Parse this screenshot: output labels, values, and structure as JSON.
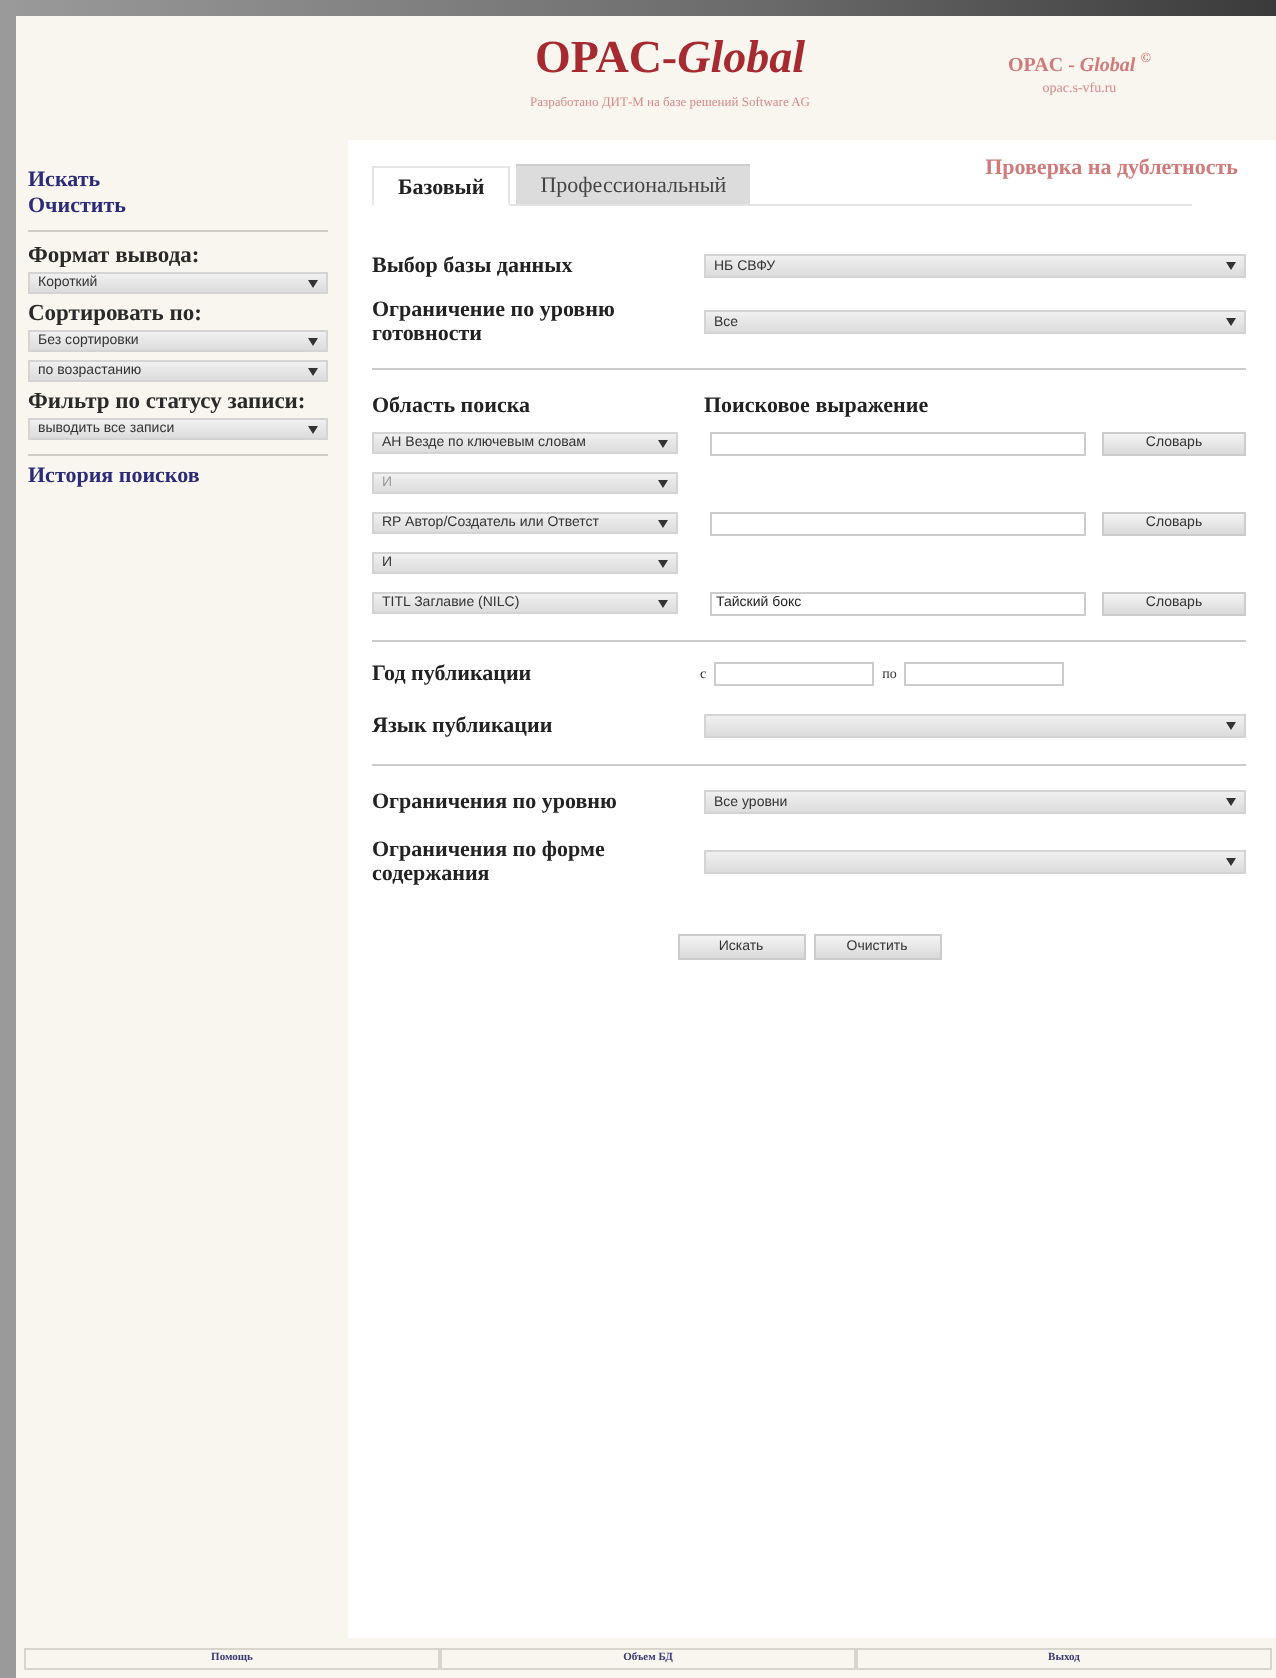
{
  "header": {
    "title": "OPAC-*Global*",
    "subtitle": "Разработано ДИТ-М на базе решений Software AG",
    "brand": "OPAC - *Global* $^{©}$",
    "site": "opac.s-vfu.ru"
  },
  "sidebar": {
    "links": [
      "Искать",
      "Очистить"
    ],
    "sections": [
      {
        "label": "Формат вывода:",
        "selects": [
          "Короткий"
        ]
      },
      {
        "label": "Сортировать по:",
        "selects": [
          "Без сортировки",
          "по возрастанию"
        ]
      },
      {
        "label": "Фильтр по статусу записи:",
        "selects": [
          "выводить все записи"
        ]
      }
    ],
    "history": "История поисков"
  },
  "tabs": [
    {
      "label": "Базовый",
      "selected": true
    },
    {
      "label": "Профессиональный",
      "selected": false
    }
  ],
  "duplicate_check": "Проверка на дублетность",
  "top_rows": [
    {
      "label": "Выбор базы данных",
      "value": "НБ СВФУ"
    },
    {
      "label": "Ограничение по уровню готовности",
      "value": "Все"
    }
  ],
  "search": {
    "area_header": "Область поиска",
    "expression_header": "Поисковое выражение",
    "rows": [
      {
        "field": "АН Везде по ключевым словам",
        "button": "Словарь"
      },
      {
        "operator": "И",
        "operator_disabled": true,
        "field": "RP Автор/Создатель или Ответст",
        "button": "Словарь"
      },
      {
        "operator": "И",
        "operator_disabled": false,
        "field": "TITL Заглавие (NILC)",
        "value": "Тайский бокс",
        "button": "Словарь"
      }
    ]
  },
  "year": {
    "label": "Год публикации",
    "from_label": "с",
    "to_label": "по"
  },
  "language": {
    "label": "Язык публикации"
  },
  "bottom_rows": [
    {
      "label": "Ограничения по уровню",
      "value": "Все уровни"
    },
    {
      "label": "Ограничения по форме содержания"
    }
  ],
  "buttons": [
    "Искать",
    "Очистить"
  ],
  "footer": [
    "Помощь",
    "Объем БД",
    "Выход"
  ]
}
